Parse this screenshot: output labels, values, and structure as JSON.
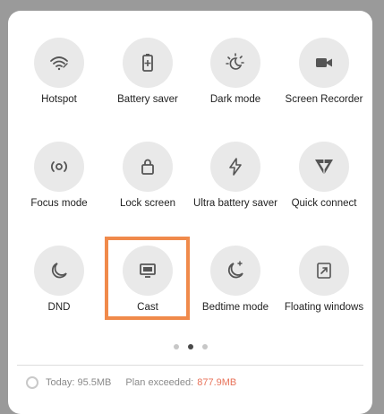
{
  "tiles": [
    {
      "label": "Hotspot",
      "icon": "hotspot-icon"
    },
    {
      "label": "Battery saver",
      "icon": "battery-saver-icon"
    },
    {
      "label": "Dark mode",
      "icon": "dark-mode-icon"
    },
    {
      "label": "Screen Recorder",
      "icon": "screen-recorder-icon"
    },
    {
      "label": "Focus mode",
      "icon": "focus-mode-icon"
    },
    {
      "label": "Lock screen",
      "icon": "lock-icon"
    },
    {
      "label": "Ultra battery saver",
      "icon": "lightning-icon"
    },
    {
      "label": "Quick connect",
      "icon": "quick-connect-icon"
    },
    {
      "label": "DND",
      "icon": "moon-icon"
    },
    {
      "label": "Cast",
      "icon": "cast-icon"
    },
    {
      "label": "Bedtime mode",
      "icon": "bedtime-icon"
    },
    {
      "label": "Floating windows",
      "icon": "floating-windows-icon"
    }
  ],
  "highlight_color": "#f08a4b",
  "pager": {
    "pages": 3,
    "active": 2
  },
  "usage": {
    "today_label": "Today: 95.5MB",
    "plan_label": "Plan exceeded:",
    "plan_value": "877.9MB",
    "exceeded_color": "#e8735a"
  }
}
